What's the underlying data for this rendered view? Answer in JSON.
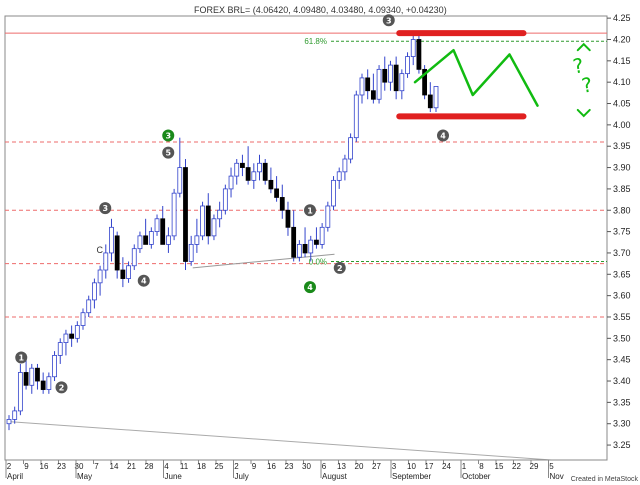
{
  "chart_data": {
    "type": "candlestick",
    "title": "FOREX BRL= (4.06420, 4.09480, 4.03480, 4.09340, +0.04230)",
    "credit": "Created in MetaStock",
    "y_ticks": [
      3.25,
      3.3,
      3.35,
      3.4,
      3.45,
      3.5,
      3.55,
      3.6,
      3.65,
      3.7,
      3.75,
      3.8,
      3.85,
      3.9,
      3.95,
      4.0,
      4.05,
      4.1,
      4.15,
      4.2,
      4.25
    ],
    "ylim": [
      3.215,
      4.255
    ],
    "x_day_ticks": [
      "2",
      "9",
      "16",
      "23",
      "30",
      "7",
      "14",
      "21",
      "28",
      "4",
      "11",
      "18",
      "25",
      "2",
      "9",
      "16",
      "23",
      "30",
      "6",
      "13",
      "20",
      "27",
      "3",
      "10",
      "17",
      "24",
      "1",
      "8",
      "15",
      "22",
      "29",
      "5"
    ],
    "x_months": [
      {
        "label": "April",
        "tick": 0
      },
      {
        "label": "May",
        "tick": 4
      },
      {
        "label": "June",
        "tick": 9
      },
      {
        "label": "July",
        "tick": 13
      },
      {
        "label": "August",
        "tick": 18
      },
      {
        "label": "September",
        "tick": 22
      },
      {
        "label": "October",
        "tick": 26
      },
      {
        "label": "Nov",
        "tick": 31
      }
    ],
    "horizontal_levels": [
      {
        "value": 4.215,
        "color": "#ee6b6b",
        "style": "solid"
      },
      {
        "value": 3.96,
        "color": "#ee6b6b",
        "style": "dashed"
      },
      {
        "value": 3.8,
        "color": "#ee6b6b",
        "style": "dashed"
      },
      {
        "value": 3.675,
        "color": "#ee6b6b",
        "style": "dashed"
      },
      {
        "value": 3.55,
        "color": "#ee6b6b",
        "style": "dashed"
      }
    ],
    "fib_levels": [
      {
        "label": "61.8%",
        "value": 4.196
      },
      {
        "label": "0.0%",
        "value": 3.68
      }
    ],
    "trendlines": [
      {
        "x1": 0,
        "y1": 3.305,
        "x2": 31,
        "y2": 3.215,
        "color": "#aaaaaa"
      },
      {
        "x1": 10.5,
        "y1": 3.665,
        "x2": 18.6,
        "y2": 3.697,
        "color": "#999999"
      }
    ],
    "wave_labels": [
      {
        "text": "1",
        "tick": 0.7,
        "value": 3.455,
        "color": "#555555"
      },
      {
        "text": "2",
        "tick": 3.0,
        "value": 3.385,
        "color": "#555555"
      },
      {
        "text": "3",
        "tick": 5.5,
        "value": 3.805,
        "color": "#555555"
      },
      {
        "text": "4",
        "tick": 7.7,
        "value": 3.635,
        "color": "#555555"
      },
      {
        "text": "3",
        "tick": 9.1,
        "value": 3.975,
        "color": "#1a8a1a"
      },
      {
        "text": "5",
        "tick": 9.1,
        "value": 3.935,
        "color": "#555555"
      },
      {
        "text": "1",
        "tick": 17.2,
        "value": 3.8,
        "color": "#555555"
      },
      {
        "text": "2",
        "tick": 18.9,
        "value": 3.665,
        "color": "#555555"
      },
      {
        "text": "4",
        "tick": 17.2,
        "value": 3.62,
        "color": "#1a8a1a"
      },
      {
        "text": "3",
        "tick": 21.7,
        "value": 4.245,
        "color": "#555555"
      },
      {
        "text": "4",
        "tick": 24.8,
        "value": 3.975,
        "color": "#555555"
      }
    ],
    "annotations": [
      {
        "text": "C",
        "tick": 5.0,
        "value": 3.7
      }
    ],
    "candles": [
      [
        3.3,
        3.32,
        3.285,
        3.31
      ],
      [
        3.31,
        3.34,
        3.3,
        3.33
      ],
      [
        3.33,
        3.44,
        3.32,
        3.42
      ],
      [
        3.42,
        3.45,
        3.38,
        3.39
      ],
      [
        3.39,
        3.44,
        3.37,
        3.43
      ],
      [
        3.43,
        3.44,
        3.38,
        3.4
      ],
      [
        3.4,
        3.42,
        3.37,
        3.38
      ],
      [
        3.38,
        3.42,
        3.37,
        3.41
      ],
      [
        3.41,
        3.47,
        3.4,
        3.46
      ],
      [
        3.46,
        3.5,
        3.44,
        3.49
      ],
      [
        3.49,
        3.52,
        3.46,
        3.51
      ],
      [
        3.51,
        3.53,
        3.48,
        3.5
      ],
      [
        3.5,
        3.54,
        3.49,
        3.53
      ],
      [
        3.53,
        3.57,
        3.52,
        3.56
      ],
      [
        3.56,
        3.6,
        3.55,
        3.59
      ],
      [
        3.59,
        3.64,
        3.57,
        3.63
      ],
      [
        3.63,
        3.67,
        3.6,
        3.66
      ],
      [
        3.66,
        3.72,
        3.64,
        3.7
      ],
      [
        3.7,
        3.78,
        3.68,
        3.76
      ],
      [
        3.74,
        3.75,
        3.64,
        3.66
      ],
      [
        3.66,
        3.69,
        3.62,
        3.64
      ],
      [
        3.64,
        3.68,
        3.63,
        3.67
      ],
      [
        3.67,
        3.72,
        3.66,
        3.71
      ],
      [
        3.71,
        3.75,
        3.7,
        3.74
      ],
      [
        3.74,
        3.78,
        3.73,
        3.72
      ],
      [
        3.72,
        3.76,
        3.71,
        3.75
      ],
      [
        3.75,
        3.79,
        3.74,
        3.78
      ],
      [
        3.78,
        3.81,
        3.75,
        3.72
      ],
      [
        3.72,
        3.76,
        3.7,
        3.74
      ],
      [
        3.74,
        3.85,
        3.73,
        3.84
      ],
      [
        3.84,
        3.97,
        3.83,
        3.9
      ],
      [
        3.9,
        3.92,
        3.66,
        3.68
      ],
      [
        3.68,
        3.74,
        3.67,
        3.72
      ],
      [
        3.72,
        3.78,
        3.7,
        3.74
      ],
      [
        3.74,
        3.82,
        3.73,
        3.81
      ],
      [
        3.81,
        3.84,
        3.72,
        3.74
      ],
      [
        3.74,
        3.79,
        3.73,
        3.78
      ],
      [
        3.78,
        3.82,
        3.76,
        3.8
      ],
      [
        3.8,
        3.86,
        3.79,
        3.85
      ],
      [
        3.85,
        3.9,
        3.83,
        3.88
      ],
      [
        3.88,
        3.92,
        3.86,
        3.91
      ],
      [
        3.91,
        3.93,
        3.88,
        3.9
      ],
      [
        3.9,
        3.95,
        3.86,
        3.87
      ],
      [
        3.87,
        3.91,
        3.85,
        3.89
      ],
      [
        3.89,
        3.93,
        3.87,
        3.91
      ],
      [
        3.91,
        3.92,
        3.86,
        3.87
      ],
      [
        3.87,
        3.9,
        3.84,
        3.85
      ],
      [
        3.85,
        3.88,
        3.82,
        3.83
      ],
      [
        3.83,
        3.86,
        3.78,
        3.8
      ],
      [
        3.8,
        3.82,
        3.74,
        3.76
      ],
      [
        3.76,
        3.8,
        3.68,
        3.69
      ],
      [
        3.69,
        3.73,
        3.68,
        3.72
      ],
      [
        3.72,
        3.76,
        3.69,
        3.7
      ],
      [
        3.7,
        3.74,
        3.68,
        3.73
      ],
      [
        3.73,
        3.76,
        3.71,
        3.72
      ],
      [
        3.72,
        3.77,
        3.71,
        3.76
      ],
      [
        3.76,
        3.82,
        3.75,
        3.81
      ],
      [
        3.81,
        3.88,
        3.8,
        3.87
      ],
      [
        3.87,
        3.9,
        3.85,
        3.89
      ],
      [
        3.89,
        3.93,
        3.87,
        3.92
      ],
      [
        3.92,
        3.98,
        3.91,
        3.97
      ],
      [
        3.97,
        4.08,
        3.96,
        4.07
      ],
      [
        4.07,
        4.12,
        4.05,
        4.11
      ],
      [
        4.11,
        4.13,
        4.06,
        4.08
      ],
      [
        4.08,
        4.12,
        4.05,
        4.06
      ],
      [
        4.06,
        4.14,
        4.05,
        4.13
      ],
      [
        4.13,
        4.16,
        4.08,
        4.1
      ],
      [
        4.1,
        4.15,
        4.08,
        4.14
      ],
      [
        4.14,
        4.16,
        4.06,
        4.08
      ],
      [
        4.08,
        4.13,
        4.06,
        4.12
      ],
      [
        4.12,
        4.17,
        4.11,
        4.16
      ],
      [
        4.16,
        4.22,
        4.14,
        4.2
      ],
      [
        4.2,
        4.21,
        4.12,
        4.13
      ],
      [
        4.13,
        4.14,
        4.06,
        4.07
      ],
      [
        4.07,
        4.1,
        4.03,
        4.04
      ],
      [
        4.04,
        4.09,
        4.03,
        4.09
      ]
    ],
    "hand_drawn": {
      "red_bars": [
        {
          "tick_from": 22.3,
          "tick_to": 29.4,
          "value": 4.215
        },
        {
          "tick_from": 22.3,
          "tick_to": 29.4,
          "value": 4.02
        }
      ],
      "green_color": "#11bb11",
      "red_color": "#e02020"
    }
  }
}
